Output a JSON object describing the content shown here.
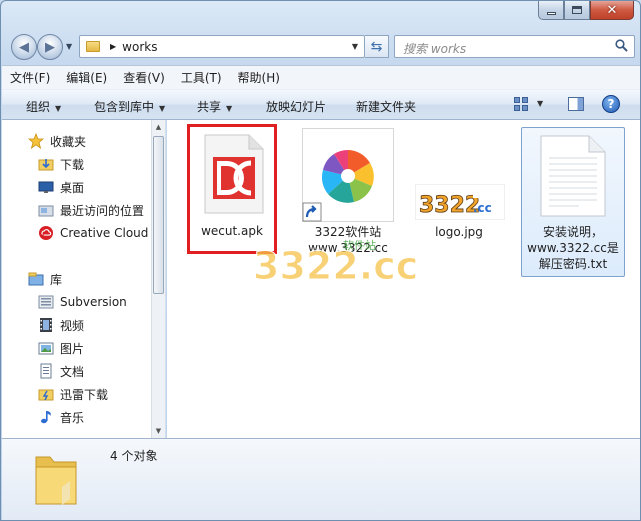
{
  "window": {
    "address_path": "works",
    "search_placeholder": "搜索 works"
  },
  "menu": [
    "文件(F)",
    "编辑(E)",
    "查看(V)",
    "工具(T)",
    "帮助(H)"
  ],
  "toolbar": {
    "organize": "组织",
    "include_in_library": "包含到库中",
    "share": "共享",
    "slideshow": "放映幻灯片",
    "new_folder": "新建文件夹"
  },
  "sidebar": {
    "favorites": "收藏夹",
    "favorites_items": [
      "下载",
      "桌面",
      "最近访问的位置",
      "Creative Cloud Files"
    ],
    "libraries": "库",
    "library_items": [
      "Subversion",
      "视频",
      "图片",
      "文档",
      "迅雷下载",
      "音乐"
    ]
  },
  "files": [
    {
      "name": "wecut.apk",
      "icon": "apk-icon"
    },
    {
      "name": "3322软件站\nwww.3322.cc",
      "line1": "3322软件站",
      "line2": "www.3322.cc",
      "icon": "shortcut-icon"
    },
    {
      "name": "logo.jpg",
      "icon": "image-icon"
    },
    {
      "name": "安装说明，www.3322.cc是解压密码.txt",
      "line1": "安装说明，",
      "line2": "www.3322.cc是",
      "line3": "解压密码.txt",
      "icon": "text-file-icon"
    }
  ],
  "details": {
    "count": "4 个对象"
  },
  "watermark": {
    "text": "3322.cc",
    "sub": "软件站"
  },
  "colors": {
    "highlight_border": "#e02020",
    "accent": "#3f6fae"
  }
}
